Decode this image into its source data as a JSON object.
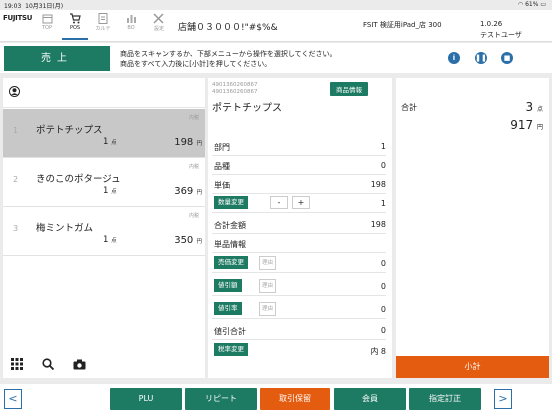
{
  "status": {
    "time": "19:03",
    "date": "10月31日(月)",
    "battery": "61%"
  },
  "header": {
    "logo": "FUJITSU",
    "nav": [
      {
        "label": "TOP",
        "icon": "calendar-icon"
      },
      {
        "label": "POS",
        "icon": "cart-icon"
      },
      {
        "label": "カルテ",
        "icon": "document-icon"
      },
      {
        "label": "BO",
        "icon": "chart-icon"
      },
      {
        "label": "設定",
        "icon": "tools-icon"
      }
    ],
    "store": "店舗０３０００!\"#$%&",
    "terminal": "FSIT 検証用iPad_店 300",
    "version": "1.0.26",
    "user": "テストユーザ"
  },
  "subbar": {
    "sale_label": "売上",
    "message_line1": "商品をスキャンするか、下部メニューから操作を選択してください。",
    "message_line2": "商品をすべて入力後に[小計]を押してください。"
  },
  "items": [
    {
      "num": "1",
      "name": "ポテトチップス",
      "tax": "内税",
      "qty": "1",
      "qty_unit": "点",
      "price": "198",
      "price_unit": "円"
    },
    {
      "num": "2",
      "name": "きのこのポタージュ",
      "tax": "内税",
      "qty": "1",
      "qty_unit": "点",
      "price": "369",
      "price_unit": "円"
    },
    {
      "num": "3",
      "name": "梅ミントガム",
      "tax": "内税",
      "qty": "1",
      "qty_unit": "点",
      "price": "350",
      "price_unit": "円"
    }
  ],
  "detail": {
    "code1": "4901360260867",
    "code2": "4901360260867",
    "name": "ポテトチップス",
    "info_btn": "商品情報",
    "dept_label": "部門",
    "dept": "1",
    "kind_label": "品種",
    "kind": "0",
    "unit_price_label": "単価",
    "unit_price": "198",
    "qty_btn": "数量変更",
    "minus": "-",
    "plus": "+",
    "qty": "1",
    "total_label": "合計金額",
    "total": "198",
    "unit_info_label": "単品情報",
    "price_change_btn": "売価変更",
    "reason": "理由",
    "price_change": "0",
    "discount_btn": "値引額",
    "discount": "0",
    "discount_rate_btn": "値引率",
    "discount_rate": "0",
    "discount_total_label": "値引合計",
    "discount_total": "0",
    "tax_btn": "税率変更",
    "tax": "内 8"
  },
  "summary": {
    "label": "合計",
    "count": "3",
    "count_unit": "点",
    "amount": "917",
    "amount_unit": "円",
    "subtotal_btn": "小計"
  },
  "footer": {
    "prev": "<",
    "next": ">",
    "plu": "PLU",
    "repeat": "リピート",
    "hold": "取引保留",
    "member": "会員",
    "correct": "指定訂正"
  }
}
